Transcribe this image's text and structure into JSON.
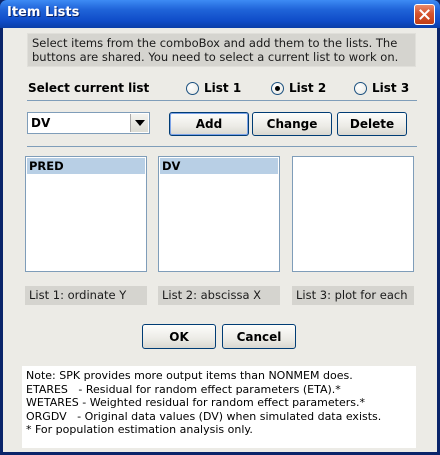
{
  "window": {
    "title": "Item Lists"
  },
  "instructions": "Select items from the comboBox and add them to the lists.  The buttons are shared.  You need to select a current list to work on.",
  "select_label": "Select current  list",
  "radio_options": [
    {
      "label": "List 1",
      "selected": false
    },
    {
      "label": "List 2",
      "selected": true
    },
    {
      "label": "List 3",
      "selected": false
    }
  ],
  "combo": {
    "value": "DV"
  },
  "buttons": {
    "add": "Add",
    "change": "Change",
    "delete": "Delete",
    "ok": "OK",
    "cancel": "Cancel"
  },
  "lists": [
    {
      "items": [
        "PRED"
      ],
      "caption": "List 1: ordinate Y"
    },
    {
      "items": [
        "DV"
      ],
      "caption": "List 2: abscissa X"
    },
    {
      "items": [],
      "caption": "List 3: plot for each"
    }
  ],
  "notes": [
    "Note: SPK provides more output items than NONMEM does.",
    "ETARES   - Residual for random effect parameters (ETA).*",
    "WETARES - Weighted residual for random effect parameters.*",
    "ORGDV   - Original data values (DV) when simulated data exists.",
    "* For population estimation analysis only."
  ],
  "colors": {
    "title_bar": "#0f4cc8",
    "dialog_bg": "#ecebe6",
    "selection": "#b8cfe5"
  },
  "icons": {
    "close": "close-icon",
    "dropdown": "chevron-down-icon"
  }
}
